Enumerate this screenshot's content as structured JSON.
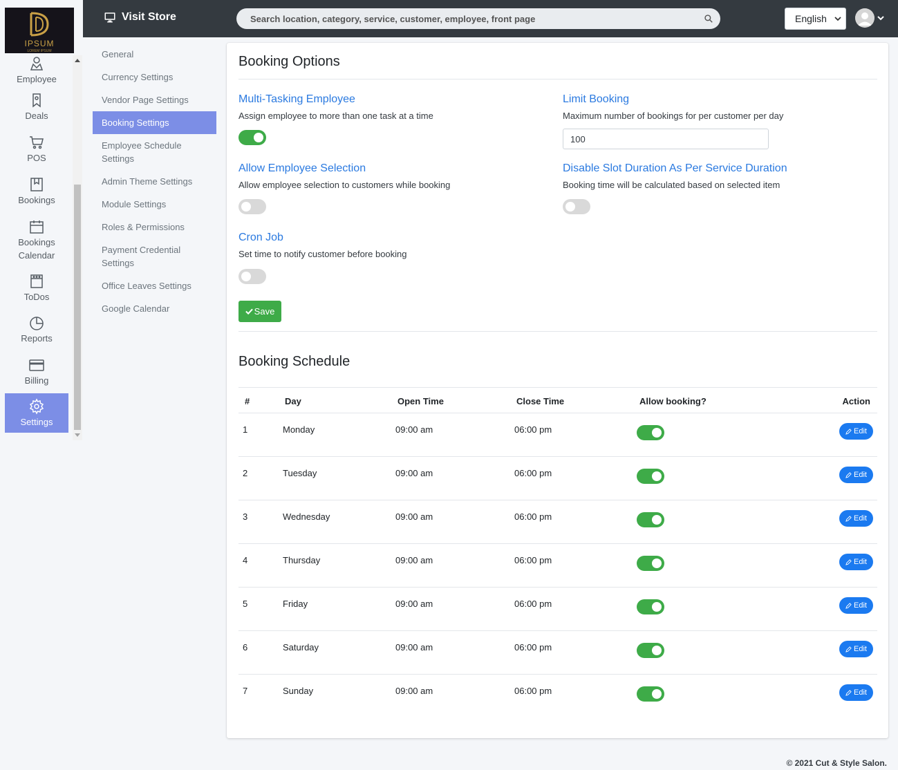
{
  "brand": {
    "logo_text": "IPSUM",
    "logo_sub": "LOREM IPSUM"
  },
  "sidebar": {
    "items": [
      {
        "label": "Employee",
        "icon": "employee-icon"
      },
      {
        "label": "Deals",
        "icon": "deals-icon"
      },
      {
        "label": "POS",
        "icon": "cart-icon"
      },
      {
        "label": "Bookings",
        "icon": "bookings-icon"
      },
      {
        "label": "Bookings Calendar",
        "icon": "calendar-icon"
      },
      {
        "label": "ToDos",
        "icon": "todos-icon"
      },
      {
        "label": "Reports",
        "icon": "pie-chart-icon"
      },
      {
        "label": "Billing",
        "icon": "credit-card-icon"
      },
      {
        "label": "Settings",
        "icon": "gear-icon",
        "active": true
      }
    ]
  },
  "topbar": {
    "visit_store": "Visit Store",
    "search_placeholder": "Search location, category, service, customer, employee, front page",
    "language": "English"
  },
  "submenu": {
    "items": [
      "General",
      "Currency Settings",
      "Vendor Page Settings",
      "Booking Settings",
      "Employee Schedule Settings",
      "Admin Theme Settings",
      "Module Settings",
      "Roles & Permissions",
      "Payment Credential Settings",
      "Office Leaves Settings",
      "Google Calendar"
    ],
    "active_index": 3
  },
  "booking_options": {
    "title": "Booking Options",
    "multitask": {
      "title": "Multi-Tasking Employee",
      "desc": "Assign employee to more than one task at a time",
      "enabled": true
    },
    "limit": {
      "title": "Limit Booking",
      "desc": "Maximum number of bookings for per customer per day",
      "value": "100"
    },
    "allow_selection": {
      "title": "Allow Employee Selection",
      "desc": "Allow employee selection to customers while booking",
      "enabled": false
    },
    "disable_slot": {
      "title": "Disable Slot Duration As Per Service Duration",
      "desc": "Booking time will be calculated based on selected item",
      "enabled": false
    },
    "cron": {
      "title": "Cron Job",
      "desc": "Set time to notify customer before booking",
      "enabled": false
    },
    "save_label": "Save"
  },
  "booking_schedule": {
    "title": "Booking Schedule",
    "columns": [
      "#",
      "Day",
      "Open Time",
      "Close Time",
      "Allow booking?",
      "Action"
    ],
    "edit_label": "Edit",
    "rows": [
      {
        "num": "1",
        "day": "Monday",
        "open": "09:00 am",
        "close": "06:00 pm",
        "allow": true
      },
      {
        "num": "2",
        "day": "Tuesday",
        "open": "09:00 am",
        "close": "06:00 pm",
        "allow": true
      },
      {
        "num": "3",
        "day": "Wednesday",
        "open": "09:00 am",
        "close": "06:00 pm",
        "allow": true
      },
      {
        "num": "4",
        "day": "Thursday",
        "open": "09:00 am",
        "close": "06:00 pm",
        "allow": true
      },
      {
        "num": "5",
        "day": "Friday",
        "open": "09:00 am",
        "close": "06:00 pm",
        "allow": true
      },
      {
        "num": "6",
        "day": "Saturday",
        "open": "09:00 am",
        "close": "06:00 pm",
        "allow": true
      },
      {
        "num": "7",
        "day": "Sunday",
        "open": "09:00 am",
        "close": "06:00 pm",
        "allow": true
      }
    ]
  },
  "footer": {
    "text": "© 2021 Cut & Style Salon."
  },
  "colors": {
    "accent": "#7c8ee6",
    "topbar": "#343a40",
    "link": "#2b7ae0",
    "success": "#3eab48",
    "primary": "#1b7af0"
  }
}
